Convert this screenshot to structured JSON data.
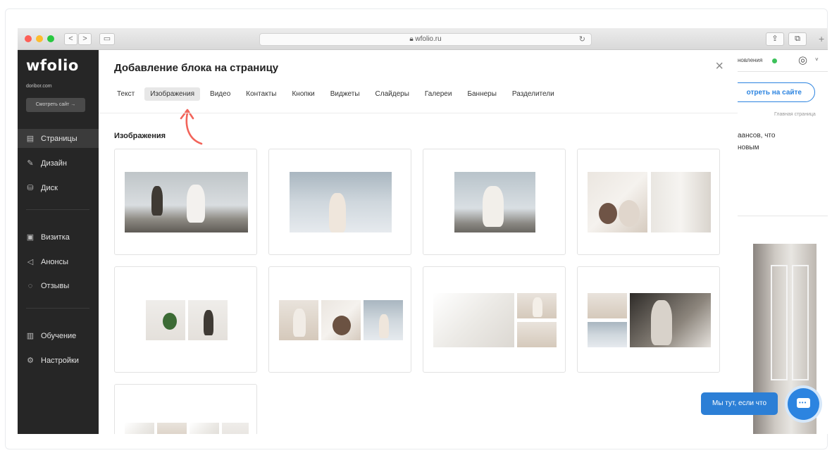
{
  "browser": {
    "url": "wfolio.ru",
    "nav_back": "<",
    "nav_forward": ">"
  },
  "sidebar": {
    "logo": "wfolio",
    "domain": "doribor.com",
    "view_site": "Смотреть сайт →",
    "items": [
      {
        "label": "Страницы",
        "icon": "page-icon"
      },
      {
        "label": "Дизайн",
        "icon": "brush-icon"
      },
      {
        "label": "Диск",
        "icon": "disk-icon"
      },
      {
        "label": "Визитка",
        "icon": "card-icon"
      },
      {
        "label": "Анонсы",
        "icon": "megaphone-icon"
      },
      {
        "label": "Отзывы",
        "icon": "chat-icon"
      },
      {
        "label": "Обучение",
        "icon": "book-icon"
      },
      {
        "label": "Настройки",
        "icon": "gear-icon"
      }
    ]
  },
  "background": {
    "status": "новления",
    "view_site_button": "отреть на сайте",
    "breadcrumb": "Главная страница",
    "text_line1": "аансов, что",
    "text_line2": "новым"
  },
  "modal": {
    "title": "Добавление блока на страницу",
    "close": "×",
    "tabs": [
      "Текст",
      "Изображения",
      "Видео",
      "Контакты",
      "Кнопки",
      "Виджеты",
      "Слайдеры",
      "Галереи",
      "Баннеры",
      "Разделители"
    ],
    "selected_tab": "Изображения",
    "section_label": "Изображения",
    "tile_count": 9
  },
  "chat": {
    "label": "Мы тут, если что"
  },
  "colors": {
    "accent": "#2c84e0",
    "sidebar_bg": "#262626",
    "arrow": "#f2645a"
  }
}
